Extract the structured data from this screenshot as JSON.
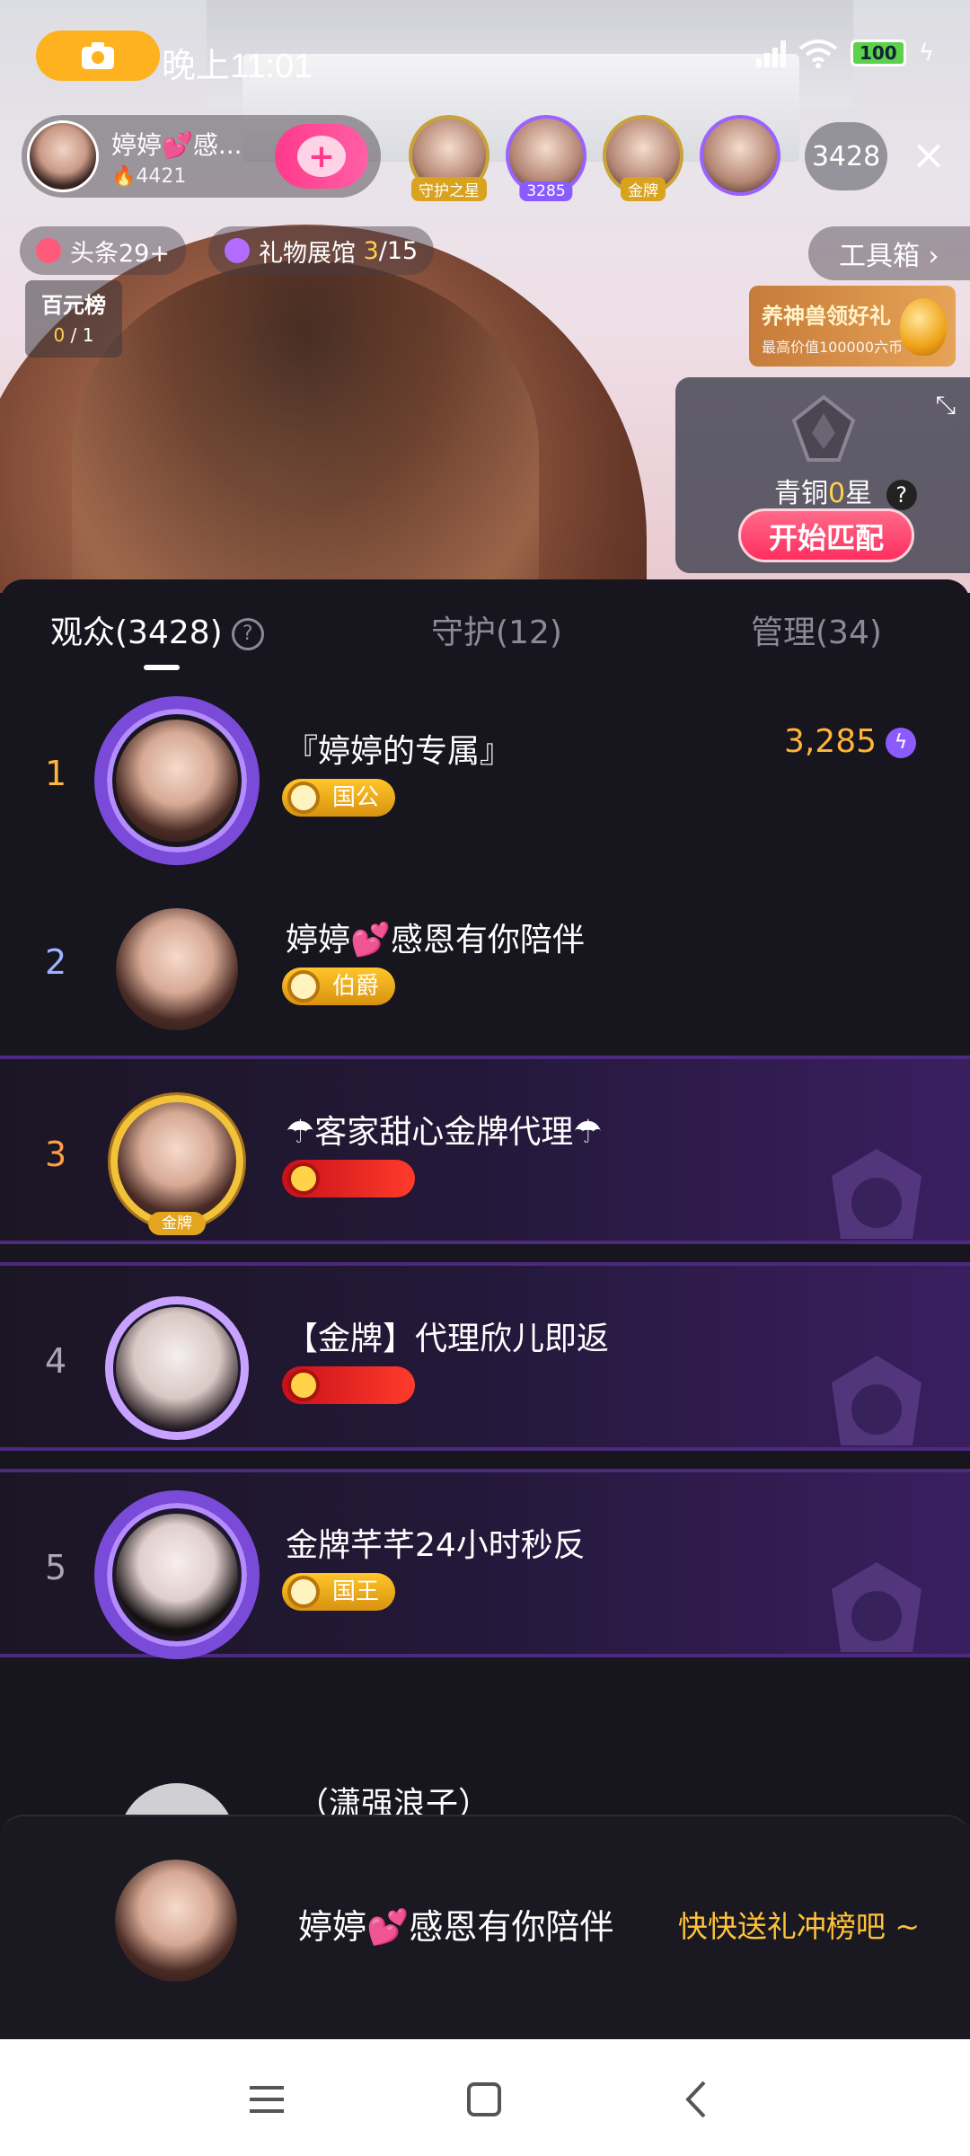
{
  "status_bar": {
    "time": "晚上11:01",
    "battery": "100",
    "icons": [
      "camera-icon",
      "signal-icon",
      "wifi-icon",
      "battery-icon",
      "charging-icon"
    ]
  },
  "anchor": {
    "name": "婷婷💕感...",
    "hot": "🔥4421"
  },
  "top_viewers": {
    "tags": [
      "守护之星",
      "3285",
      "金牌",
      ""
    ],
    "count": "3428"
  },
  "chips": {
    "headline": "头条29+",
    "gift_hall_label": "礼物展馆",
    "gift_hall_progress": "3",
    "gift_hall_total": "/15"
  },
  "rank_card": {
    "title": "百元榜",
    "current": "0",
    "total": " / 1"
  },
  "toolbox": {
    "label": "工具箱 ›"
  },
  "promo": {
    "title": "养神兽领好礼",
    "subtitle": "最高价值100000六币"
  },
  "match": {
    "level_prefix": "青铜",
    "level_num": "0",
    "level_suffix": "星",
    "button": "开始匹配"
  },
  "tabs": [
    {
      "label": "观众(3428)"
    },
    {
      "label": "守护(12)"
    },
    {
      "label": "管理(34)"
    }
  ],
  "viewers": [
    {
      "rank": "1",
      "name": "『婷婷的专属』",
      "title": "国公",
      "score": "3,285"
    },
    {
      "rank": "2",
      "name": "婷婷💕感恩有你陪伴",
      "title": "伯爵"
    },
    {
      "rank": "3",
      "name": "☂客家甜心金牌代理☂",
      "frame_tag": "金牌"
    },
    {
      "rank": "4",
      "name": "【金牌】代理欣儿即返"
    },
    {
      "rank": "5",
      "name": "金牌芊芊24小时秒反",
      "title": "国王"
    },
    {
      "name": "（潇强浪子）"
    }
  ],
  "me": {
    "name": "婷婷💕感恩有你陪伴",
    "cta": "快快送礼冲榜吧 ~"
  },
  "colors": {
    "accent_gold": "#ffb43a",
    "accent_purple": "#8b5bff",
    "cta_yellow": "#ffc23a",
    "panel_bg": "#17151d"
  }
}
